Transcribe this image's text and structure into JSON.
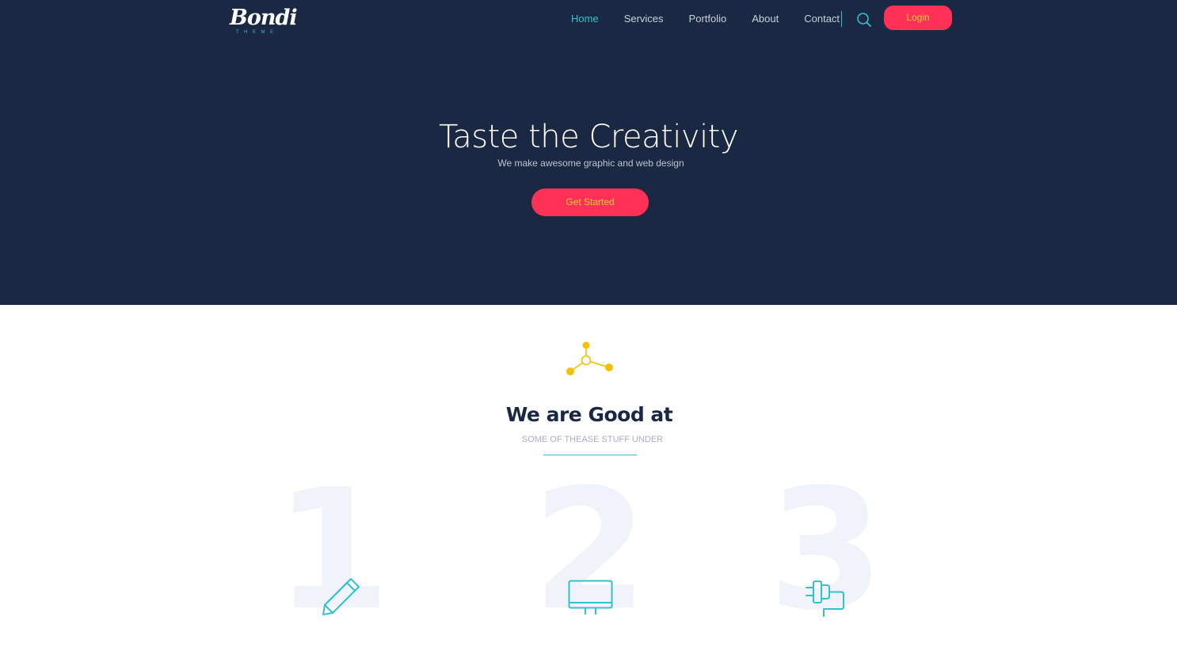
{
  "brand": {
    "name": "Bondi",
    "sub": "THEME"
  },
  "nav": {
    "items": [
      {
        "label": "Home",
        "active": true
      },
      {
        "label": "Services",
        "active": false
      },
      {
        "label": "Portfolio",
        "active": false
      },
      {
        "label": "About",
        "active": false
      },
      {
        "label": "Contact",
        "active": false
      }
    ],
    "search_icon": "search-icon",
    "login_label": "Login"
  },
  "hero": {
    "title": "Taste the Creativity",
    "subtitle": "We make awesome graphic and web design",
    "cta_label": "Get Started"
  },
  "services_section": {
    "icon": "molecule-icon",
    "title": "We are Good at",
    "subtitle": "SOME OF THEASE STUFF UNDER",
    "items": [
      {
        "number": "1",
        "icon": "pencil-icon"
      },
      {
        "number": "2",
        "icon": "monitor-icon"
      },
      {
        "number": "3",
        "icon": "plug-icon"
      }
    ]
  },
  "colors": {
    "hero_bg": "#1b2844",
    "accent_teal": "#2ec3ce",
    "accent_pink": "#ff3156",
    "button_text": "#ffcc33",
    "molecule_yellow": "#f5c000",
    "number_watermark": "#f0f4fa"
  }
}
